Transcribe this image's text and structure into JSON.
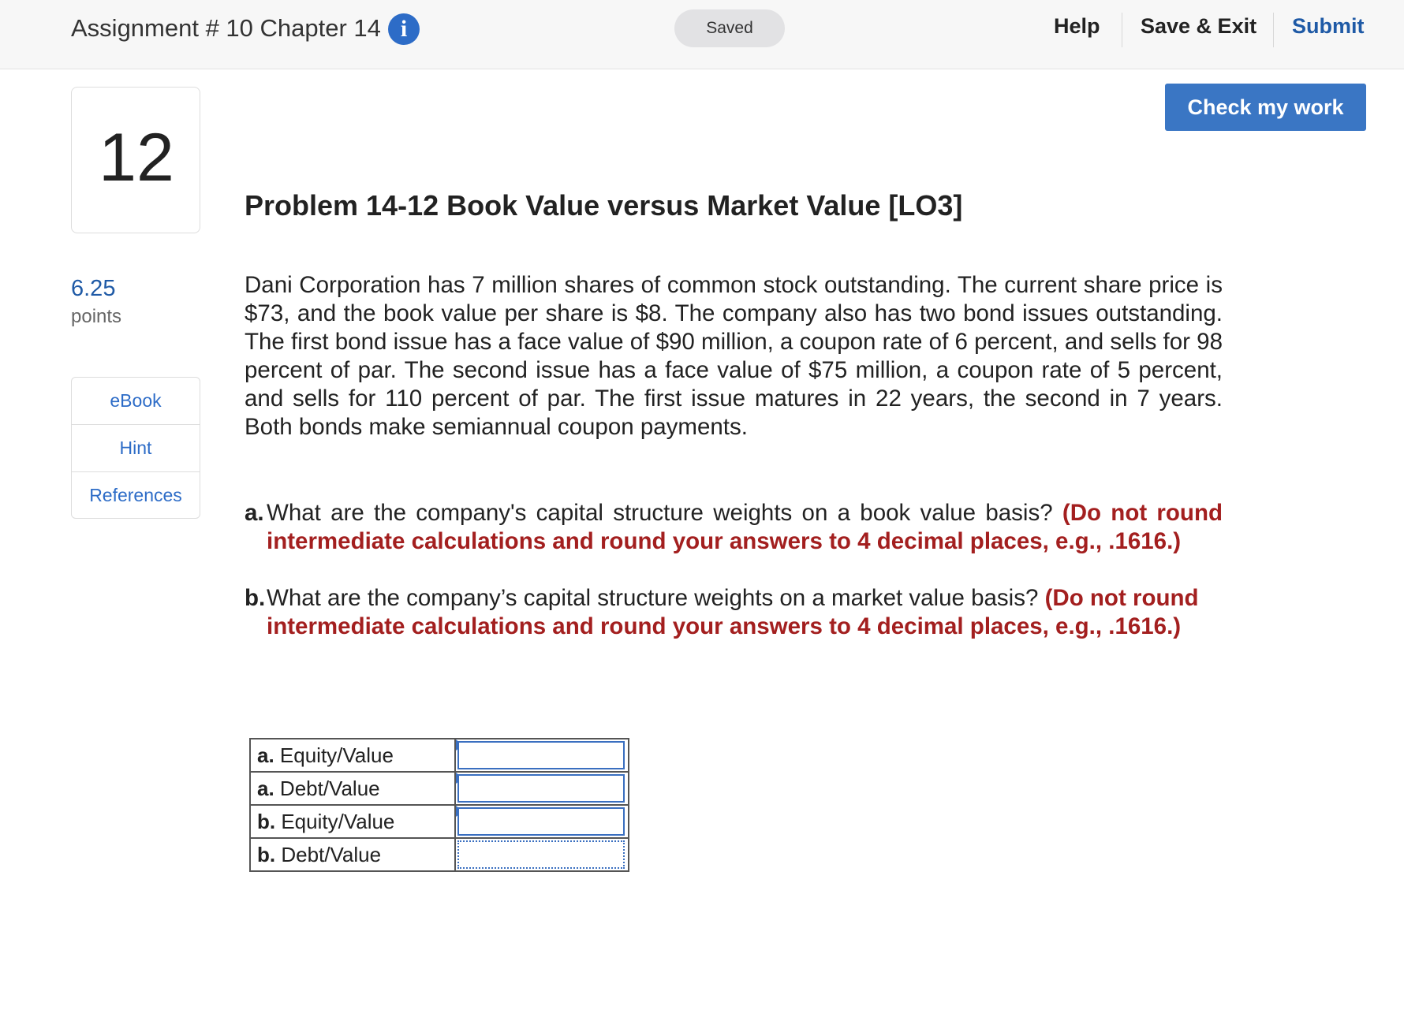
{
  "header": {
    "assignment_title": "Assignment # 10 Chapter 14",
    "info_icon": "i",
    "status": "Saved",
    "help_label": "Help",
    "save_exit_label": "Save & Exit",
    "submit_label": "Submit"
  },
  "check_work_label": "Check my work",
  "question": {
    "number": "12",
    "points_value": "6.25",
    "points_label": "points",
    "tools": [
      "eBook",
      "Hint",
      "References"
    ],
    "title": "Problem 14-12 Book Value versus Market Value [LO3]",
    "text": "Dani Corporation has 7 million shares of common stock outstanding. The current share price is $73, and the book value per share is $8. The company also has two bond issues outstanding. The first bond issue has a face value of $90 million, a coupon rate of 6 percent, and sells for 98 percent of par. The second issue has a face value of $75 million, a coupon rate of 5 percent, and sells for 110 percent of par. The first issue matures in 22 years, the second in 7 years. Both bonds make semiannual coupon payments.",
    "parts": [
      {
        "label": "a.",
        "text": "What are the company's capital structure weights on a book value basis? ",
        "instruction": "(Do not round intermediate calculations and round your answers to 4 decimal places, e.g., .1616.)"
      },
      {
        "label": "b.",
        "text": "What are the company’s capital structure weights on a market value basis? ",
        "instruction": "(Do not round intermediate calculations and round your answers to 4 decimal places, e.g., .1616.)"
      }
    ]
  },
  "answers": [
    {
      "prefix": "a.",
      "label": " Equity/Value",
      "value": ""
    },
    {
      "prefix": "a.",
      "label": " Debt/Value",
      "value": ""
    },
    {
      "prefix": "b.",
      "label": " Equity/Value",
      "value": ""
    },
    {
      "prefix": "b.",
      "label": " Debt/Value",
      "value": ""
    }
  ],
  "colors": {
    "accent": "#3a76c4",
    "link": "#2d6cc7",
    "instruction": "#a31f1f"
  }
}
